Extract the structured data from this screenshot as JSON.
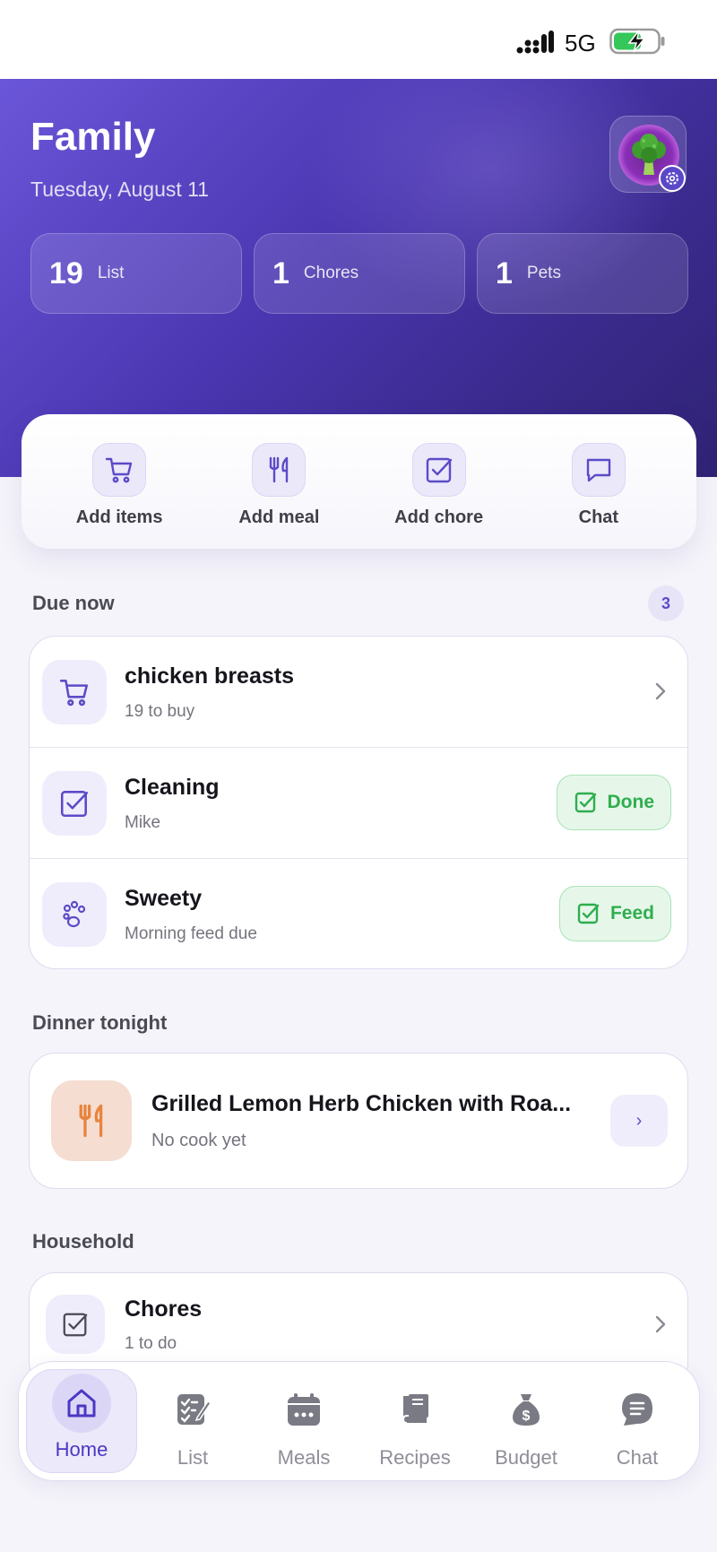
{
  "status_bar": {
    "network": "5G"
  },
  "header": {
    "title": "Family",
    "date": "Tuesday, August 11",
    "stats": [
      {
        "value": "19",
        "label": "List"
      },
      {
        "value": "1",
        "label": "Chores"
      },
      {
        "value": "1",
        "label": "Pets"
      }
    ]
  },
  "quick_actions": [
    {
      "label": "Add items",
      "icon": "cart-icon"
    },
    {
      "label": "Add meal",
      "icon": "utensils-icon"
    },
    {
      "label": "Add chore",
      "icon": "checkbox-icon"
    },
    {
      "label": "Chat",
      "icon": "chat-bubble-icon"
    }
  ],
  "due_now": {
    "title": "Due now",
    "count": "3",
    "items": [
      {
        "title": "chicken breasts",
        "subtitle": "19 to buy"
      },
      {
        "title": "Cleaning",
        "subtitle": "Mike",
        "action": "Done"
      },
      {
        "title": "Sweety",
        "subtitle": "Morning feed due",
        "action": "Feed"
      }
    ]
  },
  "dinner": {
    "title": "Dinner tonight",
    "meal": "Grilled Lemon Herb Chicken with Roa...",
    "subtitle": "No cook yet",
    "button": "›"
  },
  "household": {
    "title": "Household",
    "items": [
      {
        "title": "Chores",
        "subtitle": "1 to do"
      }
    ]
  },
  "tabs": [
    {
      "label": "Home",
      "active": true
    },
    {
      "label": "List"
    },
    {
      "label": "Meals"
    },
    {
      "label": "Recipes"
    },
    {
      "label": "Budget"
    },
    {
      "label": "Chat"
    }
  ],
  "colors": {
    "accent": "#5b4bc7",
    "header_start": "#6a56d8",
    "header_end": "#2f2374",
    "success": "#2fae4e",
    "dinner_icon": "#e8843f"
  }
}
